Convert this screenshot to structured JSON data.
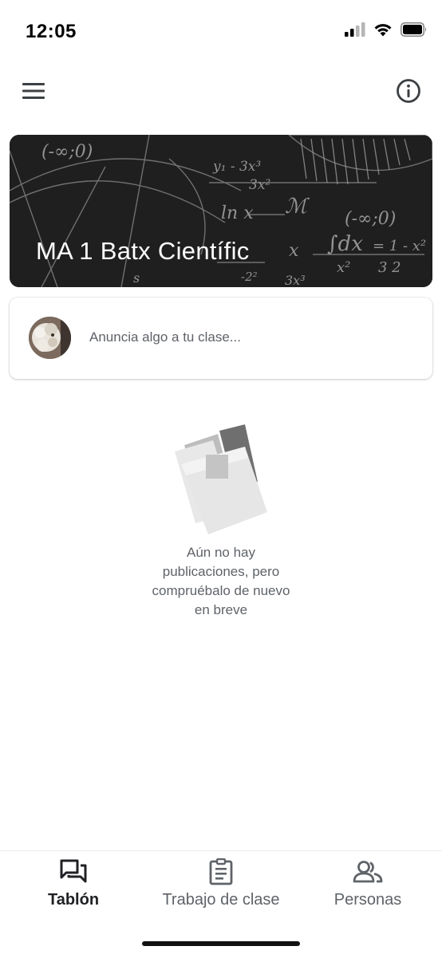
{
  "status_bar": {
    "time": "12:05"
  },
  "app_bar": {
    "menu_icon": "hamburger-menu-icon",
    "info_icon": "info-circle-icon"
  },
  "class_banner": {
    "title": "MA 1 Batx Científic"
  },
  "announce": {
    "placeholder": "Anuncia algo a tu clase..."
  },
  "empty_state": {
    "lines": [
      "Aún no hay",
      "publicaciones, pero",
      "compruébalo de nuevo",
      "en breve"
    ]
  },
  "bottom_nav": {
    "items": [
      {
        "label": "Tablón",
        "icon": "stream-icon",
        "active": true
      },
      {
        "label": "Trabajo de clase",
        "icon": "classwork-icon",
        "active": false
      },
      {
        "label": "Personas",
        "icon": "people-icon",
        "active": false
      }
    ]
  },
  "colors": {
    "banner_bg": "#1f1f1f",
    "text_primary": "#202124",
    "text_secondary": "#5f6368"
  }
}
